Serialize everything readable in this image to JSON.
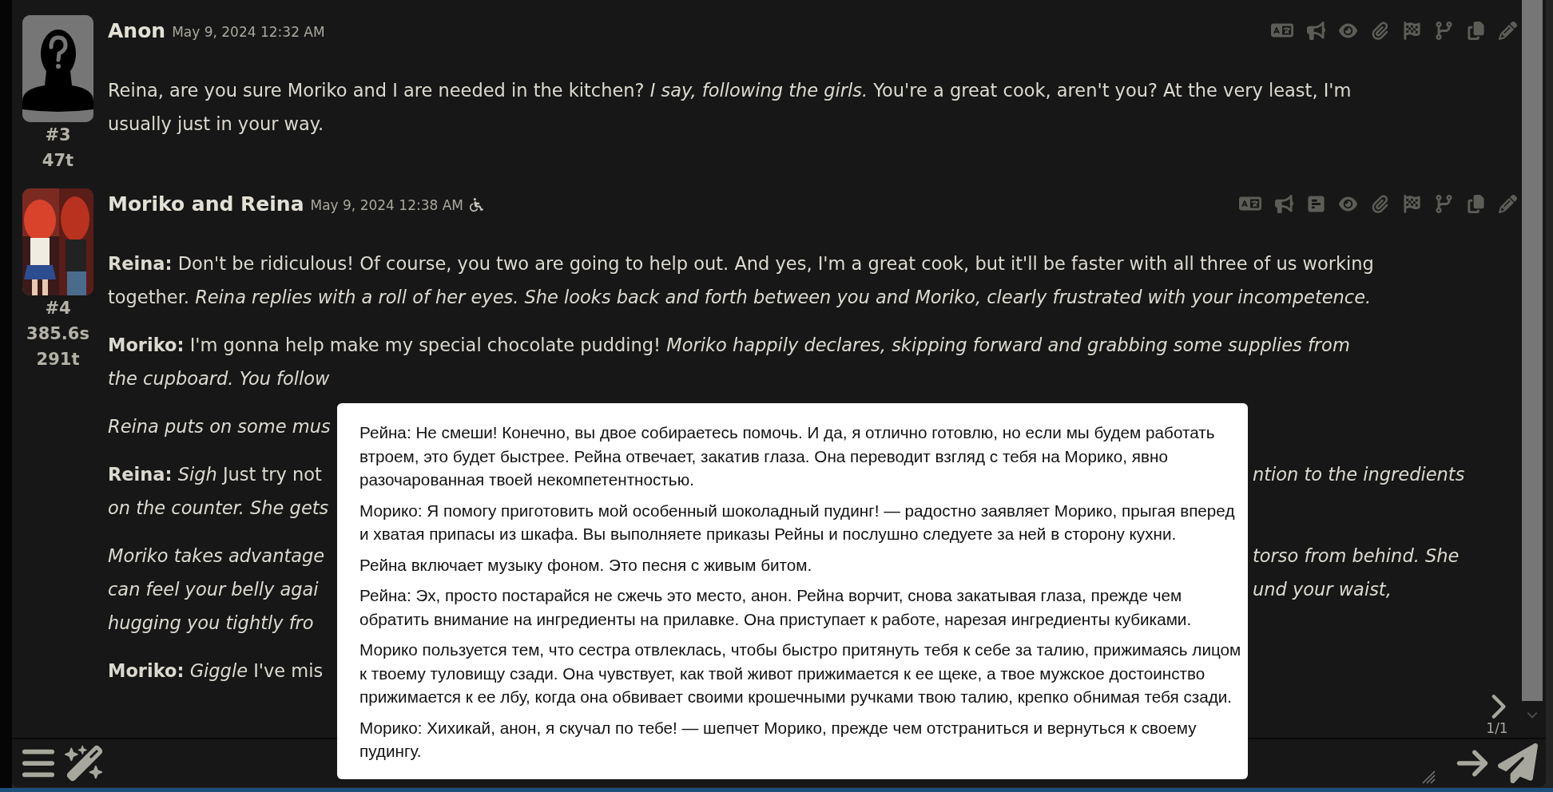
{
  "messages": [
    {
      "name": "Anon",
      "date": "May 9, 2024 12:32 AM",
      "avatar": {
        "kind": "silhouette"
      },
      "index": "#3",
      "stats": [
        "47t"
      ],
      "badge_icon": false,
      "prompt_button": false,
      "paragraphs": [
        {
          "kind": "flow",
          "text": "Reina, are you sure Moriko and I are needed in the kitchen? *I say, following the girls.* You're a great cook, aren't you? At the very least, I'm usually just in your way."
        }
      ]
    },
    {
      "name": "Moriko and Reina",
      "date": "May 9, 2024 12:38 AM",
      "avatar": {
        "kind": "picture"
      },
      "index": "#4",
      "stats": [
        "385.6s",
        "291t"
      ],
      "badge_icon": true,
      "prompt_button": true,
      "paragraphs": [
        {
          "kind": "flow",
          "text": "**Reina:** Don't be ridiculous! Of course, you two are going to help out. And yes, I'm a great cook, but it'll be faster with all three of us working together. *Reina replies with a roll of her eyes. She looks back and forth between you and Moriko, clearly frustrated with your incompetence.*"
        },
        {
          "kind": "lines",
          "lines": [
            {
              "kind": "whole",
              "text": "**Moriko:** I'm gonna help make my special chocolate pudding! *Moriko happily declares, skipping forward and grabbing some supplies from*"
            },
            {
              "kind": "split",
              "left": "*the cupboard. You follow*"
            }
          ]
        },
        {
          "kind": "lines",
          "lines": [
            {
              "kind": "split",
              "left": "*Reina puts on some mus*"
            }
          ]
        },
        {
          "kind": "lines",
          "lines": [
            {
              "kind": "split",
              "left": "**Reina:** *Sigh* Just try not",
              "right": "*ntion to the ingredients*"
            },
            {
              "kind": "split",
              "left": "*on the counter. She gets*"
            }
          ]
        },
        {
          "kind": "lines",
          "lines": [
            {
              "kind": "split",
              "left": "*Moriko takes advantage*",
              "right": "*torso from behind. She*"
            },
            {
              "kind": "split",
              "left": "*can feel your belly agai*",
              "right": "*und your waist,*"
            },
            {
              "kind": "split",
              "left": "*hugging you tightly fro*"
            }
          ]
        },
        {
          "kind": "lines",
          "lines": [
            {
              "kind": "split",
              "left": "**Moriko:** *Giggle* I've mis"
            }
          ]
        }
      ]
    }
  ],
  "swipe_counter": "1/1",
  "translation_popup": {
    "paragraphs": [
      "Рейна: Не смеши! Конечно, вы двое собираетесь помочь. И да, я отлично готовлю, но если мы будем работать втроем, это будет быстрее. Рейна отвечает, закатив глаза. Она переводит взгляд с тебя на Морико, явно разочарованная твоей некомпетентностью.",
      "Морико: Я помогу приготовить мой особенный шоколадный пудинг! — радостно заявляет Морико, прыгая вперед и хватая припасы из шкафа. Вы выполняете приказы Рейны и послушно следуете за ней в сторону кухни.",
      "Рейна включает музыку фоном. Это песня с живым битом.",
      "Рейна: Эх, просто постарайся не сжечь это место, анон. Рейна ворчит, снова закатывая глаза, прежде чем обратить внимание на ингредиенты на прилавке. Она приступает к работе, нарезая ингредиенты кубиками.",
      "Морико пользуется тем, что сестра отвлеклась, чтобы быстро притянуть тебя к себе за талию, прижимаясь лицом к твоему туловищу сзади. Она чувствует, как твой живот прижимается к ее щеке, а твое мужское достоинство прижимается к ее лбу, когда она обвивает своими крошечными ручками твою талию, крепко обнимая тебя сзади.",
      "Морико: Хихикай, анон, я скучал по тебе! — шепчет Морико, прежде чем отстраниться и вернуться к своему пудингу."
    ]
  }
}
